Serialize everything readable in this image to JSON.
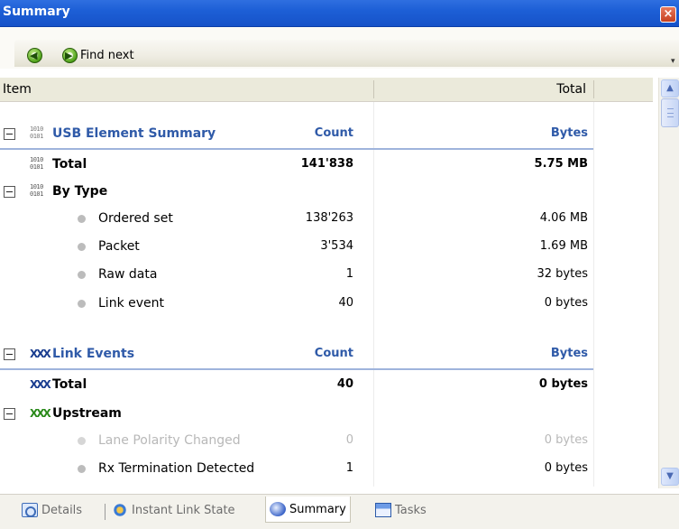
{
  "window": {
    "title": "Summary",
    "close_glyph": "×"
  },
  "toolbar": {
    "prev_icon": "green-arrow-left-icon",
    "next_icon": "green-arrow-right-icon",
    "find_next_label": "Find next",
    "overflow_glyph": "▾"
  },
  "header": {
    "item": "Item",
    "total": "Total"
  },
  "grid": {
    "usb_section": {
      "label": "USB Element Summary",
      "count": "Count",
      "bytes": "Bytes"
    },
    "usb_total": {
      "label": "Total",
      "count": "141'838",
      "bytes": "5.75 MB"
    },
    "by_type": {
      "label": "By Type"
    },
    "types": [
      {
        "label": "Ordered set",
        "count": "138'263",
        "bytes": "4.06 MB"
      },
      {
        "label": "Packet",
        "count": "3'534",
        "bytes": "1.69 MB"
      },
      {
        "label": "Raw data",
        "count": "1",
        "bytes": "32 bytes"
      },
      {
        "label": "Link event",
        "count": "40",
        "bytes": "0 bytes"
      }
    ],
    "link_section": {
      "label": "Link Events",
      "count": "Count",
      "bytes": "Bytes"
    },
    "link_total": {
      "label": "Total",
      "count": "40",
      "bytes": "0 bytes"
    },
    "upstream": {
      "label": "Upstream"
    },
    "upstream_items": [
      {
        "label": "Lane Polarity Changed",
        "count": "0",
        "bytes": "0 bytes",
        "disabled": true
      },
      {
        "label": "Rx Termination Detected",
        "count": "1",
        "bytes": "0 bytes",
        "disabled": false
      }
    ]
  },
  "tabs": [
    {
      "label": "Details",
      "icon": "details-icon"
    },
    {
      "label": "Instant Link State",
      "icon": "instant-link-state-icon"
    },
    {
      "label": "Summary",
      "icon": "summary-icon",
      "active": true
    },
    {
      "label": "Tasks",
      "icon": "tasks-icon"
    }
  ],
  "colors": {
    "titlebar": "#1d5fd6",
    "section_text": "#2f5aa8",
    "section_rule": "#9fb4dc"
  }
}
